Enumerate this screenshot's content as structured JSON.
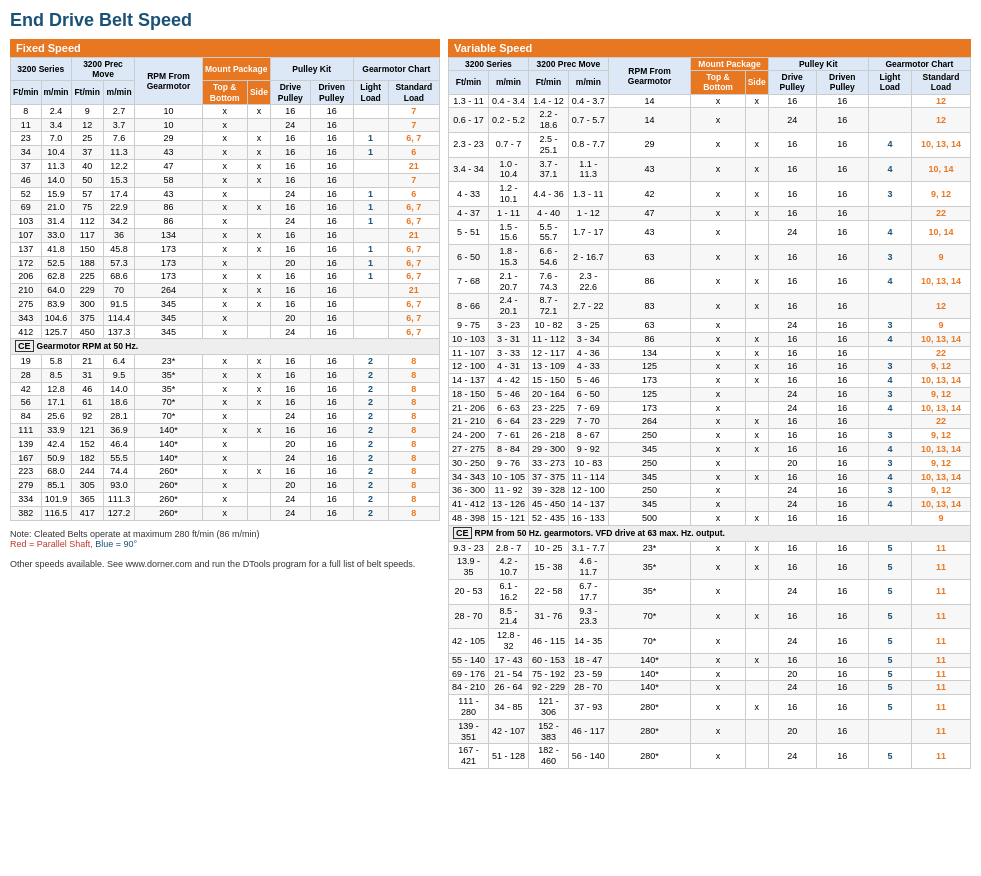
{
  "title": "End Drive Belt Speed",
  "left": {
    "fixed_speed_label": "Fixed Speed",
    "variable_speed_label": "Variable Speed",
    "headers": {
      "series_3200": "3200 Series",
      "prec_move": "3200 Prec Move",
      "rpm_from_gearmotor": "RPM From Gearmotor",
      "mount_package": "Mount Package",
      "top_bottom": "Top & Bottom",
      "side": "Side",
      "pulley_kit": "Pulley Kit",
      "drive_pulley": "Drive Pulley",
      "driven_pulley": "Driven Pulley",
      "gearmotor_chart": "Gearmotor Chart",
      "light_load": "Light Load",
      "standard_load": "Standard Load",
      "ftmin": "Ft/min",
      "mmin": "m/min"
    },
    "rows": [
      [
        "8",
        "2.4",
        "9",
        "2.7",
        "10",
        "x",
        "x",
        "16",
        "16",
        "",
        "7"
      ],
      [
        "11",
        "3.4",
        "12",
        "3.7",
        "10",
        "x",
        "",
        "24",
        "16",
        "",
        "7"
      ],
      [
        "23",
        "7.0",
        "25",
        "7.6",
        "29",
        "x",
        "x",
        "16",
        "16",
        "1",
        "6, 7"
      ],
      [
        "34",
        "10.4",
        "37",
        "11.3",
        "43",
        "x",
        "x",
        "16",
        "16",
        "1",
        "6"
      ],
      [
        "37",
        "11.3",
        "40",
        "12.2",
        "47",
        "x",
        "x",
        "16",
        "16",
        "",
        "21"
      ],
      [
        "46",
        "14.0",
        "50",
        "15.3",
        "58",
        "x",
        "x",
        "16",
        "16",
        "",
        "7"
      ],
      [
        "52",
        "15.9",
        "57",
        "17.4",
        "43",
        "x",
        "",
        "24",
        "16",
        "1",
        "6"
      ],
      [
        "69",
        "21.0",
        "75",
        "22.9",
        "86",
        "x",
        "x",
        "16",
        "16",
        "1",
        "6, 7"
      ],
      [
        "103",
        "31.4",
        "112",
        "34.2",
        "86",
        "x",
        "",
        "24",
        "16",
        "1",
        "6, 7"
      ],
      [
        "107",
        "33.0",
        "117",
        "36",
        "134",
        "x",
        "x",
        "16",
        "16",
        "",
        "21"
      ],
      [
        "137",
        "41.8",
        "150",
        "45.8",
        "173",
        "x",
        "x",
        "16",
        "16",
        "1",
        "6, 7"
      ],
      [
        "172",
        "52.5",
        "188",
        "57.3",
        "173",
        "x",
        "",
        "20",
        "16",
        "1",
        "6, 7"
      ],
      [
        "206",
        "62.8",
        "225",
        "68.6",
        "173",
        "x",
        "x",
        "16",
        "16",
        "1",
        "6, 7"
      ],
      [
        "210",
        "64.0",
        "229",
        "70",
        "264",
        "x",
        "x",
        "16",
        "16",
        "",
        "21"
      ],
      [
        "275",
        "83.9",
        "300",
        "91.5",
        "345",
        "x",
        "x",
        "16",
        "16",
        "",
        "6, 7"
      ],
      [
        "343",
        "104.6",
        "375",
        "114.4",
        "345",
        "x",
        "",
        "20",
        "16",
        "",
        "6, 7"
      ],
      [
        "412",
        "125.7",
        "450",
        "137.3",
        "345",
        "x",
        "",
        "24",
        "16",
        "",
        "6, 7"
      ]
    ],
    "ce_note_fixed": "Gearmotor RPM at 50 Hz.",
    "ce_rows": [
      [
        "19",
        "5.8",
        "21",
        "6.4",
        "23*",
        "x",
        "x",
        "16",
        "16",
        "2",
        "8"
      ],
      [
        "28",
        "8.5",
        "31",
        "9.5",
        "35*",
        "x",
        "x",
        "16",
        "16",
        "2",
        "8"
      ],
      [
        "42",
        "12.8",
        "46",
        "14.0",
        "35*",
        "x",
        "x",
        "16",
        "16",
        "2",
        "8"
      ],
      [
        "56",
        "17.1",
        "61",
        "18.6",
        "70*",
        "x",
        "x",
        "16",
        "16",
        "2",
        "8"
      ],
      [
        "84",
        "25.6",
        "92",
        "28.1",
        "70*",
        "x",
        "",
        "24",
        "16",
        "2",
        "8"
      ],
      [
        "111",
        "33.9",
        "121",
        "36.9",
        "140*",
        "x",
        "x",
        "16",
        "16",
        "2",
        "8"
      ],
      [
        "139",
        "42.4",
        "152",
        "46.4",
        "140*",
        "x",
        "",
        "20",
        "16",
        "2",
        "8"
      ],
      [
        "167",
        "50.9",
        "182",
        "55.5",
        "140*",
        "x",
        "",
        "24",
        "16",
        "2",
        "8"
      ],
      [
        "223",
        "68.0",
        "244",
        "74.4",
        "260*",
        "x",
        "x",
        "16",
        "16",
        "2",
        "8"
      ],
      [
        "279",
        "85.1",
        "305",
        "93.0",
        "260*",
        "x",
        "",
        "20",
        "16",
        "2",
        "8"
      ],
      [
        "334",
        "101.9",
        "365",
        "111.3",
        "260*",
        "x",
        "",
        "24",
        "16",
        "2",
        "8"
      ],
      [
        "382",
        "116.5",
        "417",
        "127.2",
        "260*",
        "x",
        "",
        "24",
        "16",
        "2",
        "8"
      ]
    ]
  },
  "right": {
    "headers": {
      "series_3200": "3200 Series",
      "prec_move": "3200 Prec Move",
      "rpm_from_gearmotor": "RPM From Gearmotor",
      "mount_package": "Mount Package",
      "top_bottom": "Top & Bottom",
      "side": "Side",
      "pulley_kit": "Pulley Kit",
      "drive_pulley": "Drive Pulley",
      "driven_pulley": "Driven Pulley",
      "gearmotor_chart": "Gearmotor Chart",
      "light_load": "Light Load",
      "standard_load": "Standard Load",
      "ftmin": "Ft/min",
      "mmin": "m/min"
    },
    "rows": [
      [
        "1.3 - 11",
        "0.4 - 3.4",
        "1.4 - 12",
        "0.4 - 3.7",
        "14",
        "x",
        "x",
        "16",
        "16",
        "",
        "12"
      ],
      [
        "0.6 - 17",
        "0.2 - 5.2",
        "2.2 - 18.6",
        "0.7 - 5.7",
        "14",
        "x",
        "",
        "24",
        "16",
        "",
        "12"
      ],
      [
        "2.3 - 23",
        "0.7 - 7",
        "2.5 - 25.1",
        "0.8 - 7.7",
        "29",
        "x",
        "x",
        "16",
        "16",
        "4",
        "10, 13, 14"
      ],
      [
        "3.4 - 34",
        "1.0 - 10.4",
        "3.7 - 37.1",
        "1.1 - 11.3",
        "43",
        "x",
        "x",
        "16",
        "16",
        "4",
        "10, 14"
      ],
      [
        "4 - 33",
        "1.2 - 10.1",
        "4.4 - 36",
        "1.3 - 11",
        "42",
        "x",
        "x",
        "16",
        "16",
        "3",
        "9, 12"
      ],
      [
        "4 - 37",
        "1 - 11",
        "4 - 40",
        "1 - 12",
        "47",
        "x",
        "x",
        "16",
        "16",
        "",
        "22"
      ],
      [
        "5 - 51",
        "1.5 - 15.6",
        "5.5 - 55.7",
        "1.7 - 17",
        "43",
        "x",
        "",
        "24",
        "16",
        "4",
        "10, 14"
      ],
      [
        "6 - 50",
        "1.8 - 15.3",
        "6.6 - 54.6",
        "2 - 16.7",
        "63",
        "x",
        "x",
        "16",
        "16",
        "3",
        "9"
      ],
      [
        "7 - 68",
        "2.1 - 20.7",
        "7.6 - 74.3",
        "2.3 - 22.6",
        "86",
        "x",
        "x",
        "16",
        "16",
        "4",
        "10, 13, 14"
      ],
      [
        "8 - 66",
        "2.4 - 20.1",
        "8.7 - 72.1",
        "2.7 - 22",
        "83",
        "x",
        "x",
        "16",
        "16",
        "",
        "12"
      ],
      [
        "9 - 75",
        "3 - 23",
        "10 - 82",
        "3 - 25",
        "63",
        "x",
        "",
        "24",
        "16",
        "3",
        "9"
      ],
      [
        "10 - 103",
        "3 - 31",
        "11 - 112",
        "3 - 34",
        "86",
        "x",
        "x",
        "16",
        "16",
        "4",
        "10, 13, 14"
      ],
      [
        "11 - 107",
        "3 - 33",
        "12 - 117",
        "4 - 36",
        "134",
        "x",
        "x",
        "16",
        "16",
        "",
        "22"
      ],
      [
        "12 - 100",
        "4 - 31",
        "13 - 109",
        "4 - 33",
        "125",
        "x",
        "x",
        "16",
        "16",
        "3",
        "9, 12"
      ],
      [
        "14 - 137",
        "4 - 42",
        "15 - 150",
        "5 - 46",
        "173",
        "x",
        "x",
        "16",
        "16",
        "4",
        "10, 13, 14"
      ],
      [
        "18 - 150",
        "5 - 46",
        "20 - 164",
        "6 - 50",
        "125",
        "x",
        "",
        "24",
        "16",
        "3",
        "9, 12"
      ],
      [
        "21 - 206",
        "6 - 63",
        "23 - 225",
        "7 - 69",
        "173",
        "x",
        "",
        "24",
        "16",
        "4",
        "10, 13, 14"
      ],
      [
        "21 - 210",
        "6 - 64",
        "23 - 229",
        "7 - 70",
        "264",
        "x",
        "x",
        "16",
        "16",
        "",
        "22"
      ],
      [
        "24 - 200",
        "7 - 61",
        "26 - 218",
        "8 - 67",
        "250",
        "x",
        "x",
        "16",
        "16",
        "3",
        "9, 12"
      ],
      [
        "27 - 275",
        "8 - 84",
        "29 - 300",
        "9 - 92",
        "345",
        "x",
        "x",
        "16",
        "16",
        "4",
        "10, 13, 14"
      ],
      [
        "30 - 250",
        "9 - 76",
        "33 - 273",
        "10 - 83",
        "250",
        "x",
        "",
        "20",
        "16",
        "3",
        "9, 12"
      ],
      [
        "34 - 343",
        "10 - 105",
        "37 - 375",
        "11 - 114",
        "345",
        "x",
        "x",
        "16",
        "16",
        "4",
        "10, 13, 14"
      ],
      [
        "36 - 300",
        "11 - 92",
        "39 - 328",
        "12 - 100",
        "250",
        "x",
        "",
        "24",
        "16",
        "3",
        "9, 12"
      ],
      [
        "41 - 412",
        "13 - 126",
        "45 - 450",
        "14 - 137",
        "345",
        "x",
        "",
        "24",
        "16",
        "4",
        "10, 13, 14"
      ],
      [
        "48 - 398",
        "15 - 121",
        "52 - 435",
        "16 - 133",
        "500",
        "x",
        "x",
        "16",
        "16",
        "",
        "9"
      ]
    ],
    "ce_note": "RPM from 50 Hz. gearmotors. VFD drive at 63 max. Hz. output.",
    "ce_rows": [
      [
        "9.3 - 23",
        "2.8 - 7",
        "10 - 25",
        "3.1 - 7.7",
        "23*",
        "x",
        "x",
        "16",
        "16",
        "5",
        "11"
      ],
      [
        "13.9 - 35",
        "4.2 - 10.7",
        "15 - 38",
        "4.6 - 11.7",
        "35*",
        "x",
        "x",
        "16",
        "16",
        "5",
        "11"
      ],
      [
        "20 - 53",
        "6.1 - 16.2",
        "22 - 58",
        "6.7 - 17.7",
        "35*",
        "x",
        "",
        "24",
        "16",
        "5",
        "11"
      ],
      [
        "28 - 70",
        "8.5 - 21.4",
        "31 - 76",
        "9.3 - 23.3",
        "70*",
        "x",
        "x",
        "16",
        "16",
        "5",
        "11"
      ],
      [
        "42 - 105",
        "12.8 - 32",
        "46 - 115",
        "14 - 35",
        "70*",
        "x",
        "",
        "24",
        "16",
        "5",
        "11"
      ],
      [
        "55 - 140",
        "17 - 43",
        "60 - 153",
        "18 - 47",
        "140*",
        "x",
        "x",
        "16",
        "16",
        "5",
        "11"
      ],
      [
        "69 - 176",
        "21 - 54",
        "75 - 192",
        "23 - 59",
        "140*",
        "x",
        "",
        "20",
        "16",
        "5",
        "11"
      ],
      [
        "84 - 210",
        "26 - 64",
        "92 - 229",
        "28 - 70",
        "140*",
        "x",
        "",
        "24",
        "16",
        "5",
        "11"
      ],
      [
        "111 - 280",
        "34 - 85",
        "121 - 306",
        "37 - 93",
        "280*",
        "x",
        "x",
        "16",
        "16",
        "5",
        "11"
      ],
      [
        "139 - 351",
        "42 - 107",
        "152 - 383",
        "46 - 117",
        "280*",
        "x",
        "",
        "20",
        "16",
        "",
        "11"
      ],
      [
        "167 - 421",
        "51 - 128",
        "182 - 460",
        "56 - 140",
        "280*",
        "x",
        "",
        "24",
        "16",
        "5",
        "11"
      ]
    ]
  },
  "footer": {
    "note1": "Note: Cleated Belts operate at maximum 280 ft/min (86 m/min)",
    "note2_red": "Red = Parallel Shaft,",
    "note2_blue": "Blue = 90°",
    "note3": "Other speeds available. See www.dorner.com and run the DTools program for a full list of belt speeds."
  }
}
